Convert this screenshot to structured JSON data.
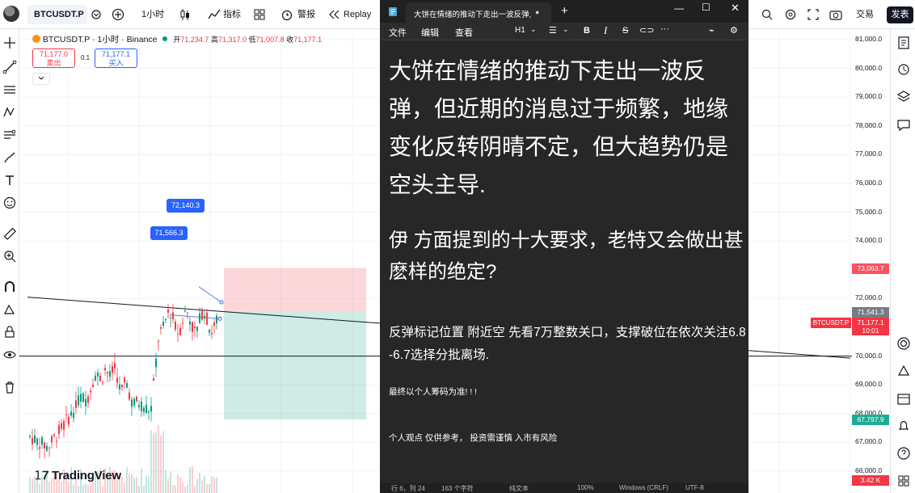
{
  "topbar": {
    "symbol": "BTCUSDT.P",
    "interval": "1小时",
    "indicators_label": "指标",
    "alert_label": "警报",
    "replay_label": "Replay",
    "trade_label": "交易",
    "publish_label": "发表"
  },
  "legend": {
    "title": "BTCUSDT.P · 1小时 · Binance",
    "open_label": "开",
    "open": "71,234.7",
    "high_label": "高",
    "high": "71,317.0",
    "low_label": "低",
    "low": "71,007.8",
    "close_label": "收",
    "close": "71,177.1"
  },
  "order": {
    "sell_price": "71,177.0",
    "sell_label": "卖出",
    "spread": "0.1",
    "buy_price": "71,177.1",
    "buy_label": "买入"
  },
  "annotations": {
    "bubble_1": "72,140.3",
    "bubble_2": "71,566.3"
  },
  "price_scale": {
    "ticks": [
      "81,000.0",
      "80,000.0",
      "79,000.0",
      "78,000.0",
      "77,000.0",
      "76,000.0",
      "75,000.0",
      "74,000.0",
      "72,000.0",
      "70,000.0",
      "69,000.0",
      "68,000.0",
      "67,000.0",
      "66,000.0"
    ],
    "labels": {
      "tp": "73,063.7",
      "entry": "71,541.3",
      "symbol_tag": "BTCUSDT.P",
      "last": "71,177.1",
      "countdown": "10:01",
      "sl": "67,797.9",
      "volume": "3.42 K"
    }
  },
  "branding": {
    "logo": "TradingView"
  },
  "colors": {
    "up": "#089981",
    "down": "#f23645",
    "accent": "#2962ff",
    "editor_bg": "#272727"
  },
  "editor": {
    "tab_title": "大饼在情绪的推动下走出一波反弹,",
    "menu": [
      "文件",
      "编辑",
      "查看"
    ],
    "heading_level": "H1",
    "heading": "大饼在情绪的推动下走出一波反弹，但近期的消息过于频繁，地缘变化反转阴晴不定，但大趋势仍是空头主导.",
    "subheading": "伊 方面提到的十大要求，老特又会做出甚麽样的绝定?",
    "paragraph": "反弹标记位置 附近空 先看7万整数关口，支撑破位在依次关注6.8 -6.7选择分批离场.",
    "note1": "最终以个人筹码为准! ! !",
    "note2": "个人观点 仅供参考， 投资需谨慎 入市有风险",
    "status": [
      "行 6，列 24",
      "163 个字符",
      "纯文本",
      "100%",
      "Windows (CRLF)",
      "UTF-8"
    ]
  }
}
